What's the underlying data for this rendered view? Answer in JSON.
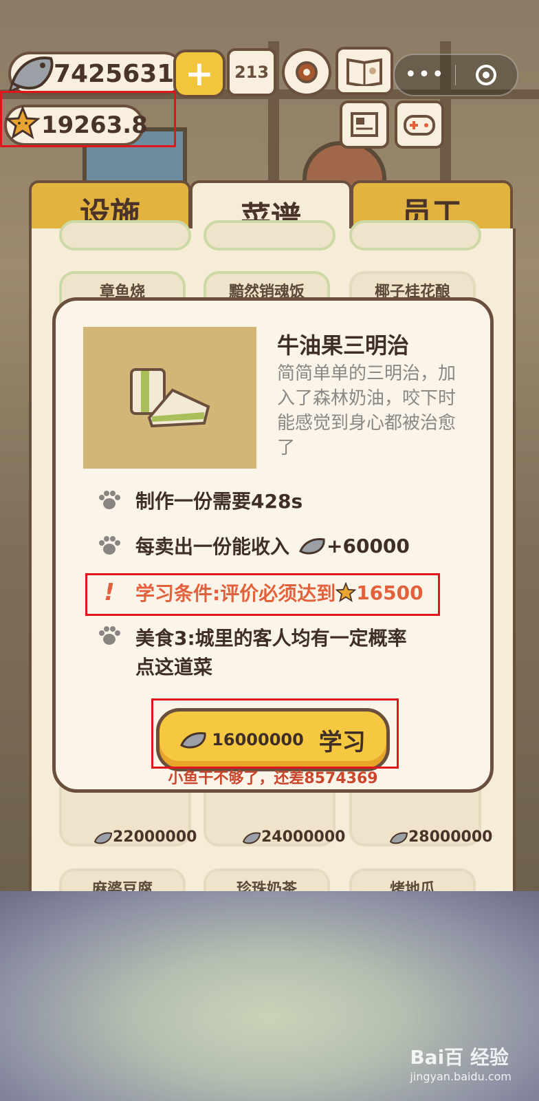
{
  "hud": {
    "fish_count": "7425631",
    "star_rating": "19263.8",
    "rank_icon_text": "213",
    "icons": [
      "fish-icon",
      "star-icon",
      "plus-icon",
      "ranking-icon",
      "settings-gear-icon",
      "book-icon",
      "news-icon",
      "gamepad-icon"
    ],
    "menu_dots": "•••"
  },
  "tabs": [
    {
      "label": "设施",
      "active": false
    },
    {
      "label": "菜谱",
      "active": true
    },
    {
      "label": "员工",
      "active": false
    }
  ],
  "background_cards": {
    "row1": [
      "章鱼烧",
      "黯然销魂饭",
      "椰子桂花酿"
    ],
    "prices": [
      "22000000",
      "24000000",
      "28000000"
    ],
    "row3": [
      "麻婆豆腐",
      "珍珠奶茶",
      "烤地瓜"
    ]
  },
  "modal": {
    "title": "牛油果三明治",
    "description": "简简单单的三明治，加入了森林奶油，咬下时能感觉到身心都被治愈了",
    "make_time": "制作一份需要428s",
    "income_prefix": "每卖出一份能收入",
    "income_value": "+60000",
    "condition_prefix": "学习条件:评价必须达到",
    "condition_value": "16500",
    "feature_line1": "美食3:城里的客人均有一定概率",
    "feature_line2": "点这道菜",
    "learn_cost": "16000000",
    "learn_label": "学习",
    "shortage": "小鱼干不够了，还差8574369"
  },
  "watermark": {
    "brand": "Bai百 经验",
    "url": "jingyan.baidu.com"
  },
  "colors": {
    "outline": "#6b4f3d",
    "accent_yellow": "#f6c842",
    "warning": "#e2613c",
    "highlight_box": "#e0141a"
  }
}
